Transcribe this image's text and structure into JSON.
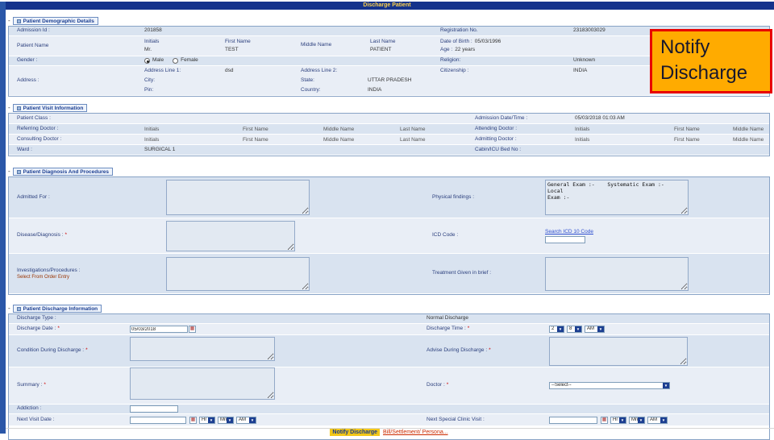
{
  "title": "Discharge Patient",
  "ui": {
    "required": "*"
  },
  "icons": {
    "calendar": "▦",
    "dropdown_arrow": "▼",
    "collapse_dash": "-"
  },
  "colors": {
    "titlebar": "#15338c",
    "title_text": "#ffd24a",
    "annotation_bg": "#ffab00",
    "annotation_border": "#e80000",
    "row_dark": "#d9e3f0",
    "row_light": "#e9eef6",
    "label_text": "#2b3f7d",
    "required_mark": "#cc0000",
    "notify_highlight": "#f3c718"
  },
  "annotation": {
    "text": "Notify Discharge"
  },
  "demo": {
    "header": "Patient Demographic Details",
    "admission_id_label": "Admission Id :",
    "admission_id_value": "201858",
    "registration_no_label": "Registration No.",
    "registration_no_value": "23183003029",
    "patient_name_label": "Patient Name",
    "initials_label": "Initials",
    "initials_value": "Mr.",
    "first_name_label": "First Name",
    "first_name_value": "TEST",
    "middle_name_label": "Middle Name",
    "last_name_label": "Last Name",
    "last_name_value": "PATIENT",
    "dob_label": "Date of Birth :",
    "dob_value": "05/03/1996",
    "age_label": "Age :",
    "age_value": "22 years",
    "gender_label": "Gender :",
    "male_label": "Male",
    "female_label": "Female",
    "religion_label": "Religion:",
    "religion_value": "Unknown",
    "address_label": "Address :",
    "address_line1_label": "Address Line 1:",
    "address_line1_value": "dsd",
    "address_line2_label": "Address Line 2:",
    "citizenship_label": "Citizenship :",
    "citizenship_value": "INDIA",
    "city_label": "City:",
    "state_label": "State:",
    "state_value": "UTTAR PRADESH",
    "pin_label": "Pin:",
    "country_label": "Country:",
    "country_value": "INDIA"
  },
  "visit": {
    "header": "Patient Visit Information",
    "patient_class_label": "Patient Class :",
    "admission_datetime_label": "Admission Date/Time :",
    "admission_datetime_value": "05/03/2018 01:03 AM",
    "referring_doctor_label": "Referring Doctor :",
    "consulting_doctor_label": "Consulting Doctor :",
    "attending_doctor_label": "Attending Doctor :",
    "admitting_doctor_label": "Admitting Doctor :",
    "initials": "Initials",
    "first_name": "First Name",
    "middle_name": "Middle Name",
    "last_name": "Last Name",
    "ward_label": "Ward :",
    "ward_value": "SURGICAL 1",
    "cabin_label": "Cabin/ICU Bed No :"
  },
  "diagnosis": {
    "header": "Patient Diagnosis And Procedures",
    "admitted_for_label": "Admitted For :",
    "physical_findings_label": "Physical findings :",
    "physical_findings_value": "General Exam :-    Systematic Exam :-    Local\nExam :-",
    "disease_label": "Disease/Diagnosis :",
    "icd_code_label": "ICD Code :",
    "icd_search_link": "Search ICD 10 Code",
    "investigations_label": "Investigations/Procedures :",
    "investigations_sub": "Select From Order Entry",
    "treatment_label": "Treatment Given in brief :"
  },
  "discharge": {
    "header": "Patient Discharge Information",
    "type_label": "Discharge Type :",
    "type_value": "Normal Discharge",
    "date_label": "Discharge Date :",
    "date_value": "05/03/2018",
    "time_label": "Discharge Time :",
    "time_hour": "2",
    "time_min": "8",
    "time_ampm": "AM",
    "condition_label": "Condition During Discharge :",
    "advise_label": "Advise During Discharge :",
    "summary_label": "Summary :",
    "doctor_label": "Doctor :",
    "doctor_value": "--Select--",
    "addiction_label": "Addiction :",
    "next_visit_label": "Next Visit Date :",
    "next_clinic_label": "Next Special Clinic Visit :",
    "hr": "Hr",
    "mn": "Mn",
    "ampm": "AM"
  },
  "footer": {
    "notify_button": "Notify Discharge",
    "bill_link": "Bill/Settlement/ Persona..."
  }
}
